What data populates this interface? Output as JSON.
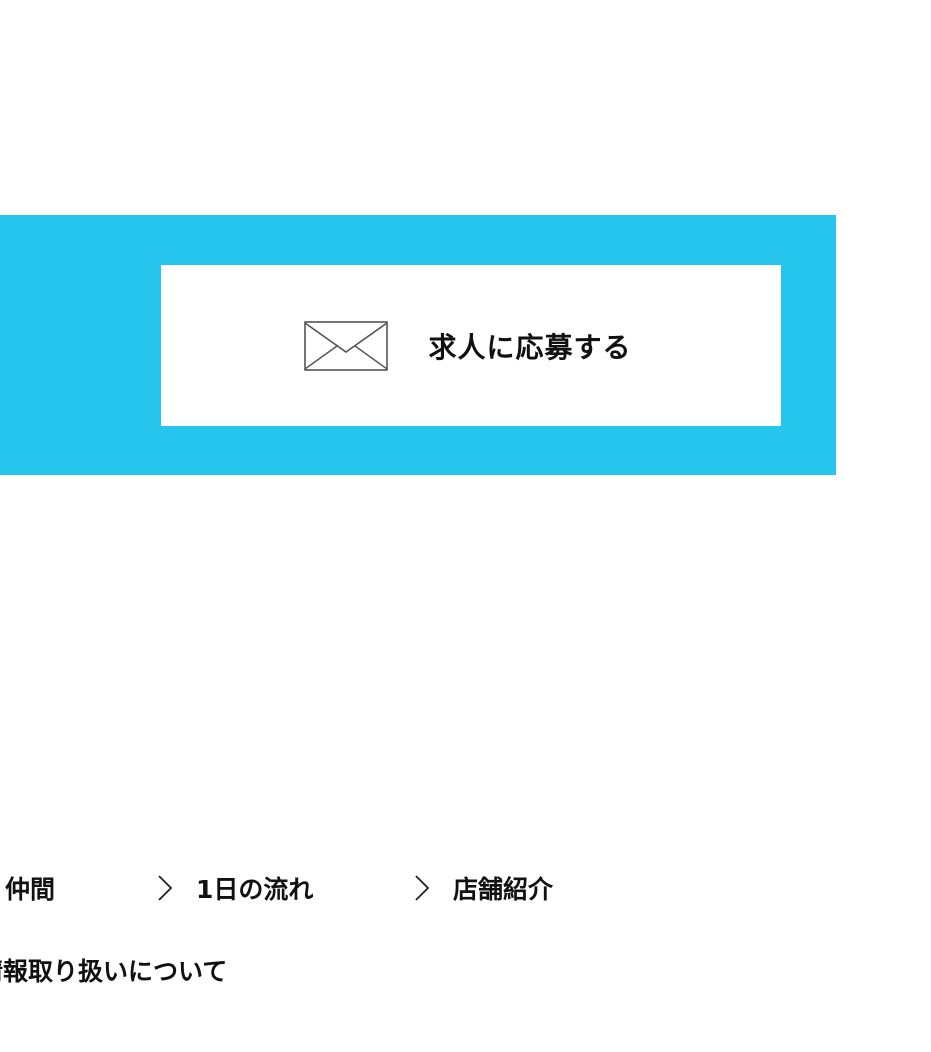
{
  "apply_section": {
    "background_color": "#26c5ee",
    "button_label": "求人に応募する",
    "icon": "mail-envelope-icon"
  },
  "footer_nav": {
    "items": [
      {
        "label": "く仲間",
        "icon": null
      },
      {
        "label": "1日の流れ",
        "icon": "chevron-right-icon"
      },
      {
        "label": "店舗紹介",
        "icon": "chevron-right-icon"
      }
    ],
    "privacy_label": "情報取り扱いについて"
  }
}
